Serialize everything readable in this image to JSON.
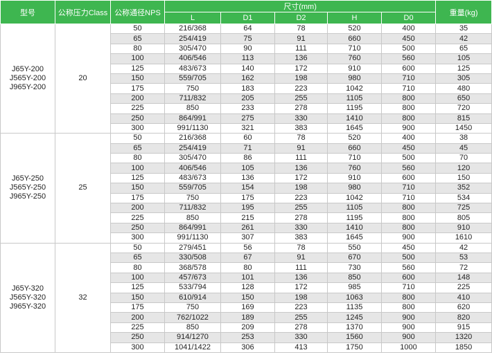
{
  "headers": {
    "model": "型号",
    "pressure": "公称压力Class",
    "nps": "公称通径NPS",
    "dimensions": "尺寸(mm)",
    "weight": "重量(kg)",
    "L": "L",
    "D1": "D1",
    "D2": "D2",
    "H": "H",
    "D0": "D0"
  },
  "groups": [
    {
      "models": [
        "J65Y-200",
        "J565Y-200",
        "J965Y-200"
      ],
      "pressure": "20",
      "rows": [
        [
          "50",
          "216/368",
          "64",
          "78",
          "520",
          "400",
          "35"
        ],
        [
          "65",
          "254/419",
          "75",
          "91",
          "660",
          "450",
          "42"
        ],
        [
          "80",
          "305/470",
          "90",
          "111",
          "710",
          "500",
          "65"
        ],
        [
          "100",
          "406/546",
          "113",
          "136",
          "760",
          "560",
          "105"
        ],
        [
          "125",
          "483/673",
          "140",
          "172",
          "910",
          "600",
          "125"
        ],
        [
          "150",
          "559/705",
          "162",
          "198",
          "980",
          "710",
          "305"
        ],
        [
          "175",
          "750",
          "183",
          "223",
          "1042",
          "710",
          "480"
        ],
        [
          "200",
          "711/832",
          "205",
          "255",
          "1105",
          "800",
          "650"
        ],
        [
          "225",
          "850",
          "233",
          "278",
          "1195",
          "800",
          "720"
        ],
        [
          "250",
          "864/991",
          "275",
          "330",
          "1410",
          "800",
          "815"
        ],
        [
          "300",
          "991/1130",
          "321",
          "383",
          "1645",
          "900",
          "1450"
        ]
      ]
    },
    {
      "models": [
        "J65Y-250",
        "J565Y-250",
        "J965Y-250"
      ],
      "pressure": "25",
      "rows": [
        [
          "50",
          "216/368",
          "60",
          "78",
          "520",
          "400",
          "38"
        ],
        [
          "65",
          "254/419",
          "71",
          "91",
          "660",
          "450",
          "45"
        ],
        [
          "80",
          "305/470",
          "86",
          "111",
          "710",
          "500",
          "70"
        ],
        [
          "100",
          "406/546",
          "105",
          "136",
          "760",
          "560",
          "120"
        ],
        [
          "125",
          "483/673",
          "136",
          "172",
          "910",
          "600",
          "150"
        ],
        [
          "150",
          "559/705",
          "154",
          "198",
          "980",
          "710",
          "352"
        ],
        [
          "175",
          "750",
          "175",
          "223",
          "1042",
          "710",
          "534"
        ],
        [
          "200",
          "711/832",
          "195",
          "255",
          "1105",
          "800",
          "725"
        ],
        [
          "225",
          "850",
          "215",
          "278",
          "1195",
          "800",
          "805"
        ],
        [
          "250",
          "864/991",
          "261",
          "330",
          "1410",
          "800",
          "910"
        ],
        [
          "300",
          "991/1130",
          "307",
          "383",
          "1645",
          "900",
          "1610"
        ]
      ]
    },
    {
      "models": [
        "J65Y-320",
        "J565Y-320",
        "J965Y-320"
      ],
      "pressure": "32",
      "rows": [
        [
          "50",
          "279/451",
          "56",
          "78",
          "550",
          "450",
          "42"
        ],
        [
          "65",
          "330/508",
          "67",
          "91",
          "670",
          "500",
          "53"
        ],
        [
          "80",
          "368/578",
          "80",
          "111",
          "730",
          "560",
          "72"
        ],
        [
          "100",
          "457/673",
          "101",
          "136",
          "850",
          "600",
          "148"
        ],
        [
          "125",
          "533/794",
          "128",
          "172",
          "985",
          "710",
          "225"
        ],
        [
          "150",
          "610/914",
          "150",
          "198",
          "1063",
          "800",
          "410"
        ],
        [
          "175",
          "750",
          "169",
          "223",
          "1135",
          "800",
          "620"
        ],
        [
          "200",
          "762/1022",
          "189",
          "255",
          "1245",
          "900",
          "820"
        ],
        [
          "225",
          "850",
          "209",
          "278",
          "1370",
          "900",
          "915"
        ],
        [
          "250",
          "914/1270",
          "253",
          "330",
          "1560",
          "900",
          "1320"
        ],
        [
          "300",
          "1041/1422",
          "306",
          "413",
          "1750",
          "1000",
          "1850"
        ]
      ]
    }
  ],
  "colors": {
    "header_bg": "#3eb650",
    "header_text": "#ffffff",
    "row_alt": "#e6e6e6",
    "border": "#c8c8c8"
  }
}
